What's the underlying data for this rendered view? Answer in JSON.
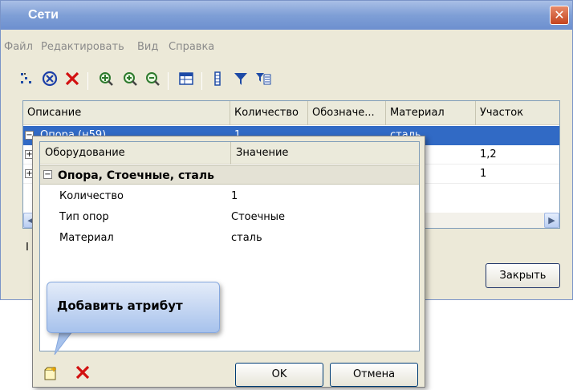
{
  "window": {
    "title": "Сети",
    "close_glyph": "✕"
  },
  "menu": {
    "items": [
      "Файл",
      "Редактировать",
      "Вид",
      "Справка"
    ]
  },
  "toolbar": {
    "icons": [
      "tree-dots-icon",
      "stop-circle-icon",
      "delete-x-icon",
      "pan-zoom-icon",
      "zoom-in-icon",
      "zoom-out-icon",
      "table-icon",
      "columns-icon",
      "filter-icon",
      "filter-list-icon"
    ]
  },
  "grid": {
    "columns": [
      "Описание",
      "Количество",
      "Обозначе...",
      "Материал",
      "Участок"
    ],
    "rows": [
      {
        "description": "Опора (н59)",
        "quantity": "1",
        "designation": "",
        "material": "сталь",
        "section": ""
      },
      {
        "description": "",
        "quantity": "",
        "designation": "",
        "material": "ь",
        "section": "1,2"
      },
      {
        "description": "",
        "quantity": "",
        "designation": "",
        "material": "ь",
        "section": "1"
      }
    ],
    "tab_label": "I"
  },
  "close_button_label": "Закрыть",
  "popup": {
    "columns": [
      "Оборудование",
      "Значение"
    ],
    "group_label": "Опора, Стоечные, сталь",
    "properties": [
      {
        "name": "Количество",
        "value": "1"
      },
      {
        "name": "Тип опор",
        "value": "Стоечные"
      },
      {
        "name": "Материал",
        "value": "сталь"
      }
    ],
    "ok_label": "OK",
    "cancel_label": "Отмена"
  },
  "callout": {
    "text": "Добавить атрибут"
  },
  "colors": {
    "selection": "#316ac5",
    "titlebar": "#7f9fd6",
    "delete_red": "#d21010"
  }
}
